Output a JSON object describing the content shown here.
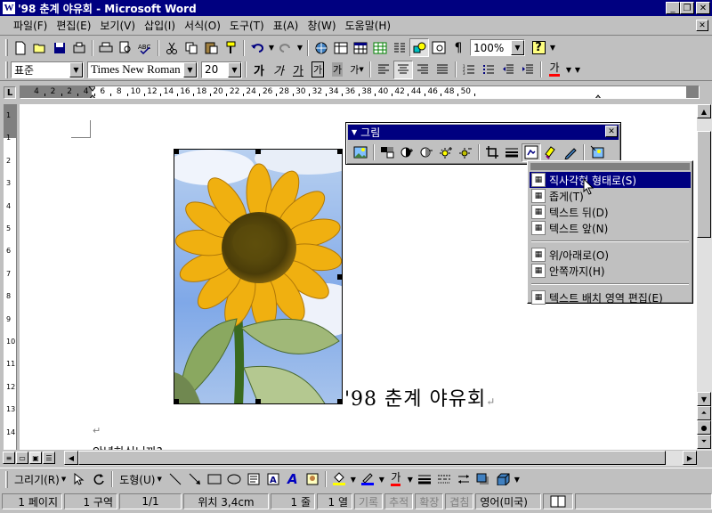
{
  "window": {
    "title": "'98 춘계 야유회 - Microsoft Word",
    "app_icon": "W",
    "buttons": {
      "minimize": "_",
      "restore": "❐",
      "close": "✕"
    }
  },
  "menu": {
    "items": [
      "파일(F)",
      "편집(E)",
      "보기(V)",
      "삽입(I)",
      "서식(O)",
      "도구(T)",
      "표(A)",
      "창(W)",
      "도움말(H)"
    ],
    "close": "✕"
  },
  "standard_toolbar": {
    "zoom": "100%",
    "help": "?"
  },
  "format_toolbar": {
    "style": "표준",
    "font": "Times New Roman",
    "size": "20",
    "bold": "가",
    "italic": "가",
    "underline": "가",
    "border_char": "가",
    "shade_char": "가",
    "phonetic": "가",
    "font_color": "가"
  },
  "ruler": {
    "corner": "L",
    "labels": [
      "4",
      "2",
      "2",
      "4",
      "6",
      "8",
      "10",
      "12",
      "14",
      "16",
      "18",
      "20",
      "22",
      "24",
      "26",
      "28",
      "30",
      "32",
      "34",
      "36",
      "38",
      "40",
      "42",
      "44",
      "46",
      "48",
      "50"
    ],
    "vlabels": [
      "1",
      "1",
      "2",
      "3",
      "4",
      "5",
      "6",
      "7",
      "8",
      "9",
      "10",
      "11",
      "12",
      "13",
      "14"
    ]
  },
  "document": {
    "heading": "'98  춘계  야유회",
    "para_mark": "↵",
    "body_line": "안녕하십니까?"
  },
  "picture_toolbar": {
    "title": "그림",
    "close": "✕"
  },
  "wrap_menu": {
    "items": [
      {
        "label": "직사각형 형태로(S)",
        "selected": true
      },
      {
        "label": "좁게(T)",
        "selected": false
      },
      {
        "label": "텍스트 뒤(D)",
        "selected": false
      },
      {
        "label": "텍스트 앞(N)",
        "selected": false
      },
      {
        "label": "위/아래로(O)",
        "selected": false
      },
      {
        "label": "안쪽까지(H)",
        "selected": false
      },
      {
        "label": "텍스트 배치 영역 편집(E)",
        "selected": false
      }
    ]
  },
  "drawing_toolbar": {
    "draw": "그리기(R)",
    "autoshapes": "도형(U)",
    "font_color": "가"
  },
  "status": {
    "page": "1 페이지",
    "section": "1 구역",
    "page_of": "1/1",
    "position": "위치 3,4cm",
    "line": "1 줄",
    "column": "1 열",
    "rec": "기록",
    "trk": "추적",
    "ext": "확장",
    "ovr": "겹침",
    "language": "영어(미국)"
  },
  "colors": {
    "title_bar": "#000080",
    "chrome": "#c0c0c0",
    "highlight": "#000080",
    "font_color_red": "#ff0000",
    "highlighter_yellow": "#ffff00"
  }
}
